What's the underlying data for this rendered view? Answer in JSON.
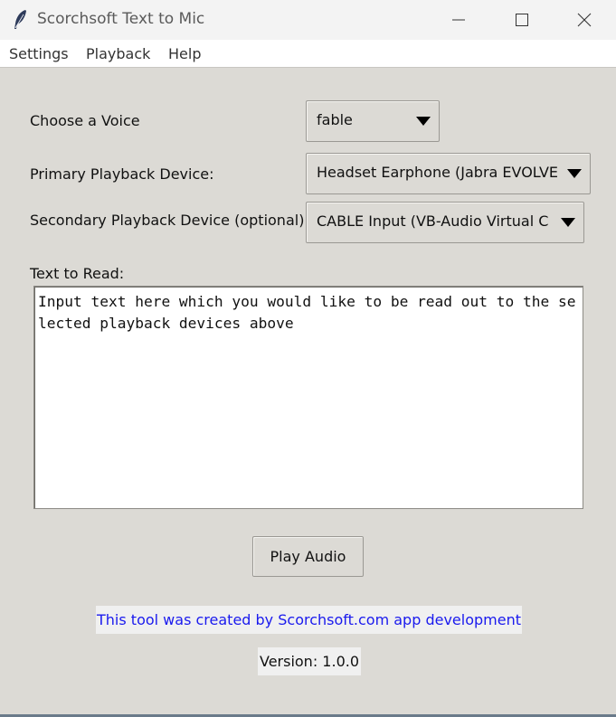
{
  "window": {
    "title": "Scorchsoft Text to Mic",
    "icon": "feather-icon",
    "controls": [
      "minimize-icon",
      "maximize-icon",
      "close-icon"
    ]
  },
  "menu": {
    "settings": "Settings",
    "playback": "Playback",
    "help": "Help"
  },
  "form": {
    "voice_label": "Choose a Voice",
    "voice_value": "fable",
    "primary_label": "Primary Playback Device:",
    "primary_value": "Headset Earphone (Jabra EVOLVE",
    "secondary_label": "Secondary Playback Device (optional):",
    "secondary_value": "CABLE Input (VB-Audio Virtual C",
    "text_label": "Text to Read:",
    "text_value": "Input text here which you would like to be read out to the selected playback devices above"
  },
  "actions": {
    "play_label": "Play Audio"
  },
  "footer": {
    "credit": "This tool was created by Scorchsoft.com app development",
    "version": "Version: 1.0.0",
    "credit_color": "#1a1aee"
  }
}
